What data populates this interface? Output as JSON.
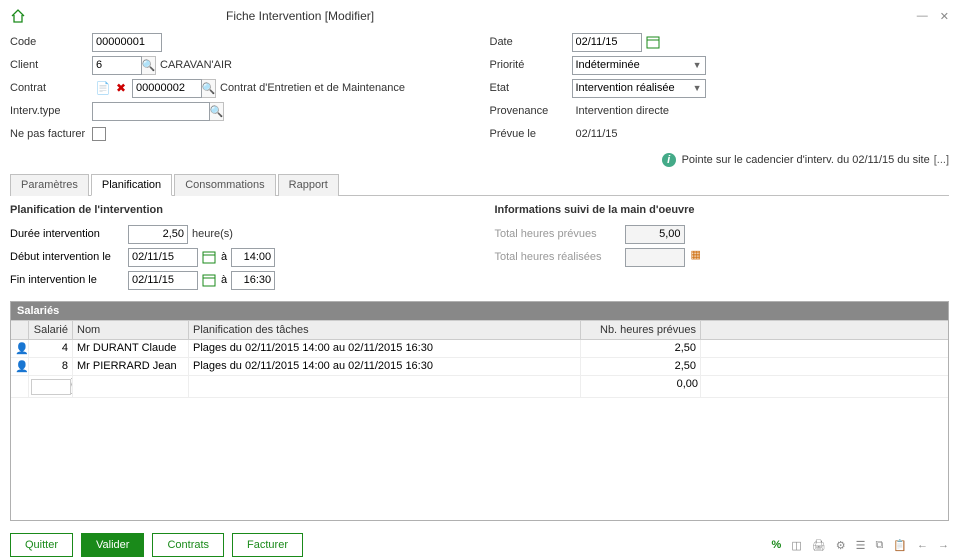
{
  "window": {
    "title": "Fiche Intervention [Modifier]"
  },
  "header": {
    "labels": {
      "code": "Code",
      "client": "Client",
      "contrat": "Contrat",
      "interv_type": "Interv.type",
      "ne_pas_facturer": "Ne pas facturer",
      "date": "Date",
      "priorite": "Priorité",
      "etat": "Etat",
      "provenance": "Provenance",
      "prevue_le": "Prévue le"
    },
    "values": {
      "code": "00000001",
      "client_code": "6",
      "client_name": "CARAVAN'AIR",
      "contrat_code": "00000002",
      "contrat_name": "Contrat d'Entretien et de Maintenance",
      "interv_type": "",
      "date": "02/11/15",
      "priorite": "Indéterminée",
      "etat": "Intervention réalisée",
      "provenance": "Intervention directe",
      "prevue_le": "02/11/15"
    },
    "info_msg": "Pointe sur le cadencier d'interv. du 02/11/15 du site",
    "info_more": "[...]"
  },
  "tabs": {
    "parametres": "Paramètres",
    "planification": "Planification",
    "consommations": "Consommations",
    "rapport": "Rapport"
  },
  "planif": {
    "title_left": "Planification de l'intervention",
    "title_right": "Informations suivi de la main d'oeuvre",
    "labels": {
      "duree": "Durée intervention",
      "heures": "heure(s)",
      "debut": "Début intervention le",
      "fin": "Fin intervention le",
      "a": "à",
      "total_prevues": "Total heures prévues",
      "total_realisees": "Total heures réalisées"
    },
    "values": {
      "duree": "2,50",
      "debut_date": "02/11/15",
      "debut_time": "14:00",
      "fin_date": "02/11/15",
      "fin_time": "16:30",
      "total_prevues": "5,00",
      "total_realisees": ""
    }
  },
  "grid": {
    "title": "Salariés",
    "columns": {
      "salarie": "Salarié",
      "nom": "Nom",
      "planif": "Planification des tâches",
      "hp": "Nb. heures prévues"
    },
    "rows": [
      {
        "salarie": "4",
        "nom": "Mr DURANT Claude",
        "planif": "Plages du 02/11/2015 14:00 au 02/11/2015 16:30",
        "hp": "2,50"
      },
      {
        "salarie": "8",
        "nom": "Mr PIERRARD Jean",
        "planif": "Plages du 02/11/2015 14:00 au 02/11/2015 16:30",
        "hp": "2,50"
      }
    ],
    "edit_row": {
      "salarie": "",
      "hp": "0,00"
    }
  },
  "footer": {
    "quitter": "Quitter",
    "valider": "Valider",
    "contrats": "Contrats",
    "facturer": "Facturer"
  }
}
